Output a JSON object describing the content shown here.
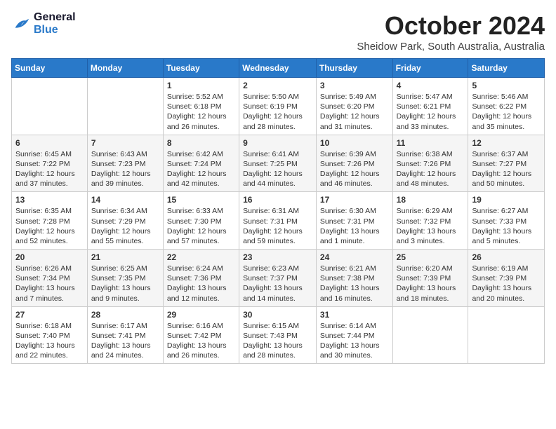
{
  "header": {
    "logo_line1": "General",
    "logo_line2": "Blue",
    "month": "October 2024",
    "location": "Sheidow Park, South Australia, Australia"
  },
  "days_of_week": [
    "Sunday",
    "Monday",
    "Tuesday",
    "Wednesday",
    "Thursday",
    "Friday",
    "Saturday"
  ],
  "weeks": [
    [
      {
        "day": "",
        "content": ""
      },
      {
        "day": "",
        "content": ""
      },
      {
        "day": "1",
        "content": "Sunrise: 5:52 AM\nSunset: 6:18 PM\nDaylight: 12 hours\nand 26 minutes."
      },
      {
        "day": "2",
        "content": "Sunrise: 5:50 AM\nSunset: 6:19 PM\nDaylight: 12 hours\nand 28 minutes."
      },
      {
        "day": "3",
        "content": "Sunrise: 5:49 AM\nSunset: 6:20 PM\nDaylight: 12 hours\nand 31 minutes."
      },
      {
        "day": "4",
        "content": "Sunrise: 5:47 AM\nSunset: 6:21 PM\nDaylight: 12 hours\nand 33 minutes."
      },
      {
        "day": "5",
        "content": "Sunrise: 5:46 AM\nSunset: 6:22 PM\nDaylight: 12 hours\nand 35 minutes."
      }
    ],
    [
      {
        "day": "6",
        "content": "Sunrise: 6:45 AM\nSunset: 7:22 PM\nDaylight: 12 hours\nand 37 minutes."
      },
      {
        "day": "7",
        "content": "Sunrise: 6:43 AM\nSunset: 7:23 PM\nDaylight: 12 hours\nand 39 minutes."
      },
      {
        "day": "8",
        "content": "Sunrise: 6:42 AM\nSunset: 7:24 PM\nDaylight: 12 hours\nand 42 minutes."
      },
      {
        "day": "9",
        "content": "Sunrise: 6:41 AM\nSunset: 7:25 PM\nDaylight: 12 hours\nand 44 minutes."
      },
      {
        "day": "10",
        "content": "Sunrise: 6:39 AM\nSunset: 7:26 PM\nDaylight: 12 hours\nand 46 minutes."
      },
      {
        "day": "11",
        "content": "Sunrise: 6:38 AM\nSunset: 7:26 PM\nDaylight: 12 hours\nand 48 minutes."
      },
      {
        "day": "12",
        "content": "Sunrise: 6:37 AM\nSunset: 7:27 PM\nDaylight: 12 hours\nand 50 minutes."
      }
    ],
    [
      {
        "day": "13",
        "content": "Sunrise: 6:35 AM\nSunset: 7:28 PM\nDaylight: 12 hours\nand 52 minutes."
      },
      {
        "day": "14",
        "content": "Sunrise: 6:34 AM\nSunset: 7:29 PM\nDaylight: 12 hours\nand 55 minutes."
      },
      {
        "day": "15",
        "content": "Sunrise: 6:33 AM\nSunset: 7:30 PM\nDaylight: 12 hours\nand 57 minutes."
      },
      {
        "day": "16",
        "content": "Sunrise: 6:31 AM\nSunset: 7:31 PM\nDaylight: 12 hours\nand 59 minutes."
      },
      {
        "day": "17",
        "content": "Sunrise: 6:30 AM\nSunset: 7:31 PM\nDaylight: 13 hours\nand 1 minute."
      },
      {
        "day": "18",
        "content": "Sunrise: 6:29 AM\nSunset: 7:32 PM\nDaylight: 13 hours\nand 3 minutes."
      },
      {
        "day": "19",
        "content": "Sunrise: 6:27 AM\nSunset: 7:33 PM\nDaylight: 13 hours\nand 5 minutes."
      }
    ],
    [
      {
        "day": "20",
        "content": "Sunrise: 6:26 AM\nSunset: 7:34 PM\nDaylight: 13 hours\nand 7 minutes."
      },
      {
        "day": "21",
        "content": "Sunrise: 6:25 AM\nSunset: 7:35 PM\nDaylight: 13 hours\nand 9 minutes."
      },
      {
        "day": "22",
        "content": "Sunrise: 6:24 AM\nSunset: 7:36 PM\nDaylight: 13 hours\nand 12 minutes."
      },
      {
        "day": "23",
        "content": "Sunrise: 6:23 AM\nSunset: 7:37 PM\nDaylight: 13 hours\nand 14 minutes."
      },
      {
        "day": "24",
        "content": "Sunrise: 6:21 AM\nSunset: 7:38 PM\nDaylight: 13 hours\nand 16 minutes."
      },
      {
        "day": "25",
        "content": "Sunrise: 6:20 AM\nSunset: 7:39 PM\nDaylight: 13 hours\nand 18 minutes."
      },
      {
        "day": "26",
        "content": "Sunrise: 6:19 AM\nSunset: 7:39 PM\nDaylight: 13 hours\nand 20 minutes."
      }
    ],
    [
      {
        "day": "27",
        "content": "Sunrise: 6:18 AM\nSunset: 7:40 PM\nDaylight: 13 hours\nand 22 minutes."
      },
      {
        "day": "28",
        "content": "Sunrise: 6:17 AM\nSunset: 7:41 PM\nDaylight: 13 hours\nand 24 minutes."
      },
      {
        "day": "29",
        "content": "Sunrise: 6:16 AM\nSunset: 7:42 PM\nDaylight: 13 hours\nand 26 minutes."
      },
      {
        "day": "30",
        "content": "Sunrise: 6:15 AM\nSunset: 7:43 PM\nDaylight: 13 hours\nand 28 minutes."
      },
      {
        "day": "31",
        "content": "Sunrise: 6:14 AM\nSunset: 7:44 PM\nDaylight: 13 hours\nand 30 minutes."
      },
      {
        "day": "",
        "content": ""
      },
      {
        "day": "",
        "content": ""
      }
    ]
  ]
}
